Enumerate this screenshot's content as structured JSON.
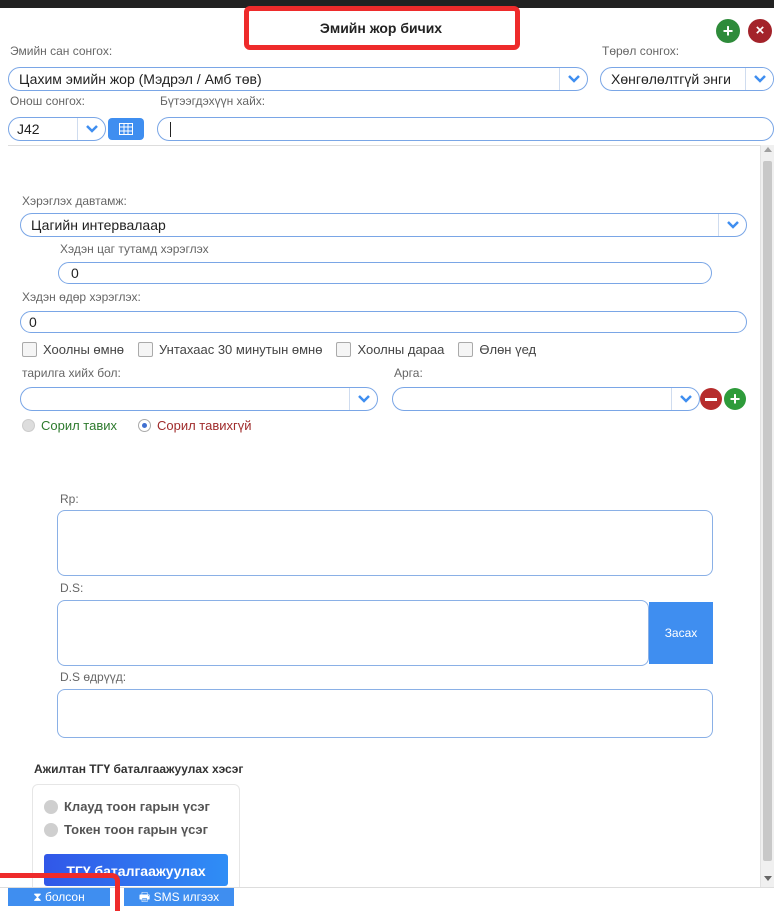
{
  "title": "Эмийн жор бичих",
  "colors": {
    "accent": "#3f8ef0",
    "add": "#2e8b3a",
    "close": "#a3232a",
    "highlight": "#ee2b2b",
    "remove": "#b62c2c"
  },
  "header": {
    "pharmacy_label": "Эмийн сан сонгох:",
    "pharmacy_value": "Цахим эмийн жор (Мэдрэл / Амб төв)",
    "type_label": "Төрөл сонгох:",
    "type_value": "Хөнгөлөлтгүй энги",
    "diagnosis_label": "Онош сонгох:",
    "diagnosis_value": "J42",
    "product_search_label": "Бүтээгдэхүүн хайх:",
    "product_search_value": ""
  },
  "form": {
    "frequency_label": "Хэрэглэх давтамж:",
    "frequency_value": "Цагийн интервалаар",
    "hours_label": "Хэдэн цаг тутамд хэрэглэх",
    "hours_value": "0",
    "days_label": "Хэдэн өдөр хэрэглэх:",
    "days_value": "0",
    "checkboxes": [
      "Хоолны өмнө",
      "Унтахаас 30 минутын өмнө",
      "Хоолны дараа",
      "Өлөн үед"
    ],
    "injection_label": "тарилга хийх бол:",
    "method_label": "Арга:",
    "radio_test": "Сорил тавих",
    "radio_no_test": "Сорил тавихгүй",
    "rp_label": "Rp:",
    "ds_label": "D.S:",
    "edit_button": "Засах",
    "ds_days_label": "D.S өдрүүд:"
  },
  "verification": {
    "title": "Ажилтан ТГҮ баталгаажуулах хэсэг",
    "cloud_option": "Клауд тоон гарын үсэг",
    "token_option": "Токен тоон гарын үсэг",
    "verify_button": "ТГҮ баталгаажуулах"
  },
  "footer": {
    "done_button": "болсон",
    "sms_button": "SMS илгээх"
  }
}
